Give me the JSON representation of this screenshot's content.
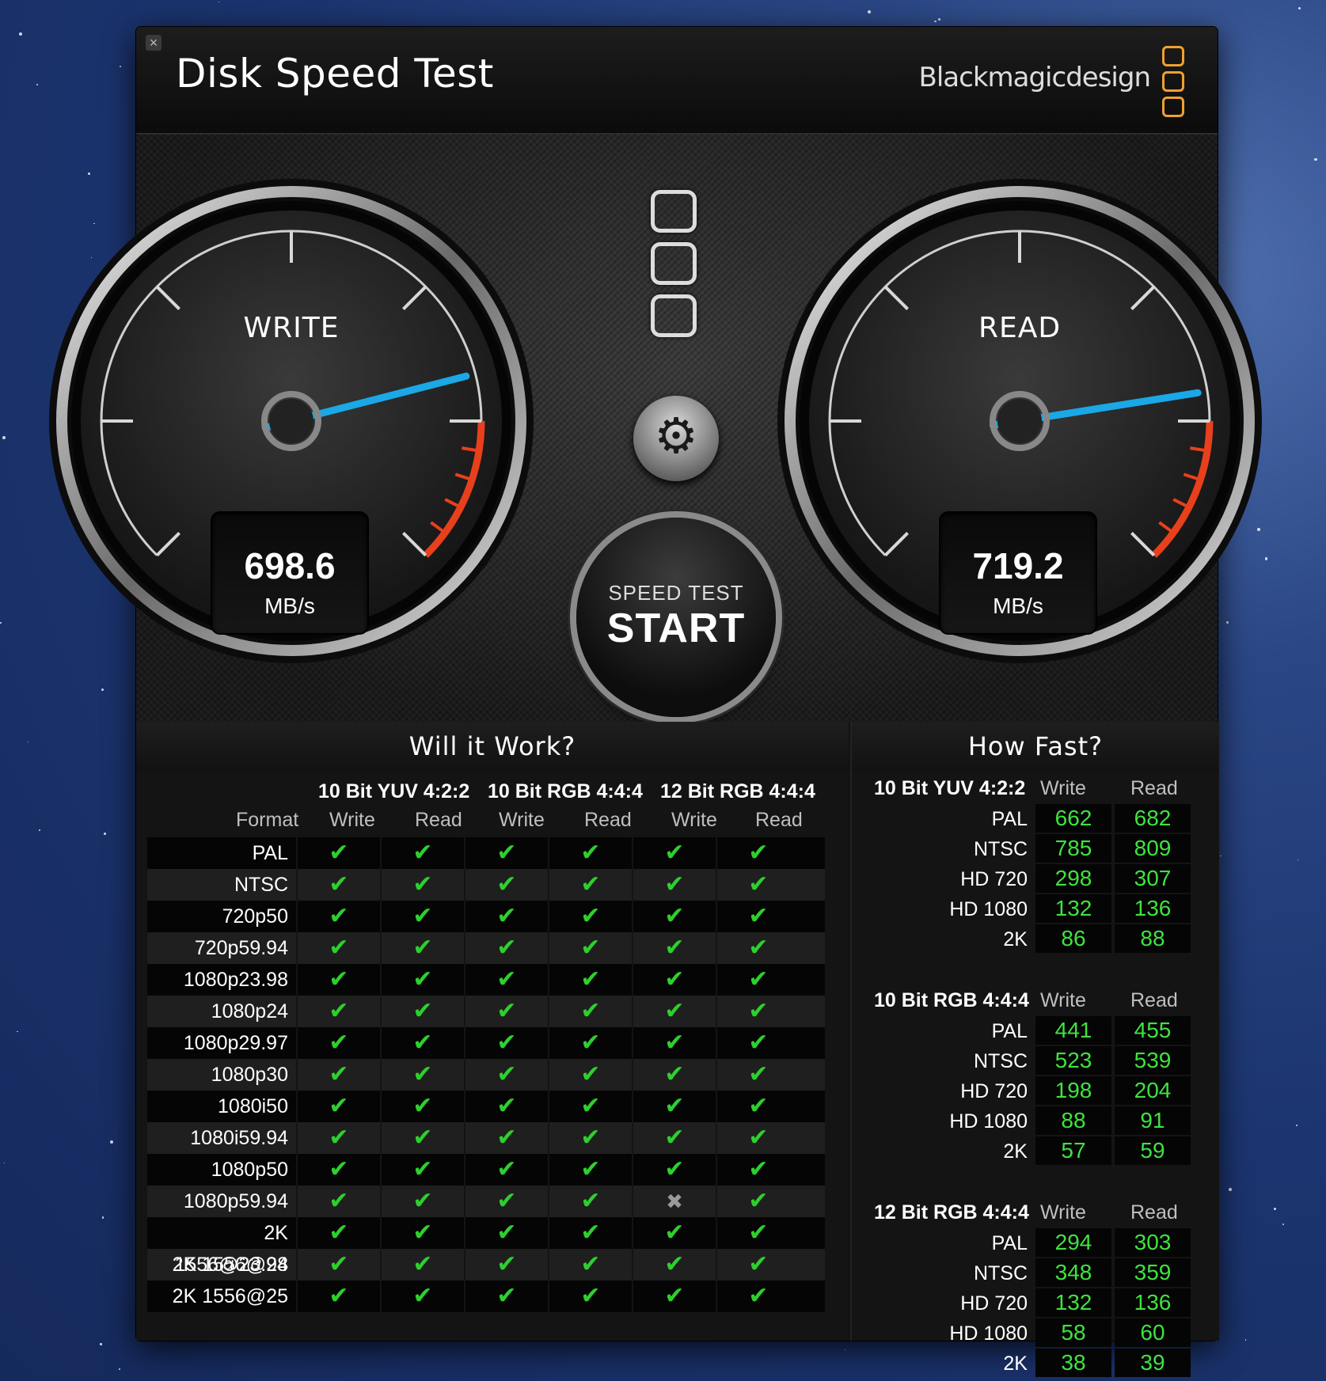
{
  "app": {
    "title": "Disk Speed Test",
    "brand": "Blackmagicdesign",
    "accent": "#f0a030"
  },
  "write_gauge": {
    "label": "WRITE",
    "value": "698.6",
    "unit": "MB/s",
    "needle_fraction": 0.78
  },
  "read_gauge": {
    "label": "READ",
    "value": "719.2",
    "unit": "MB/s",
    "needle_fraction": 0.8
  },
  "controls": {
    "settings_icon": "gear-icon",
    "start_sub": "SPEED TEST",
    "start_main": "START"
  },
  "will_it_work": {
    "title": "Will it Work?",
    "format_header": "Format",
    "groups": [
      "10 Bit YUV 4:2:2",
      "10 Bit RGB 4:4:4",
      "12 Bit RGB 4:4:4"
    ],
    "sub_headers": [
      "Write",
      "Read",
      "Write",
      "Read",
      "Write",
      "Read"
    ],
    "rows": [
      {
        "format": "PAL",
        "results": [
          true,
          true,
          true,
          true,
          true,
          true
        ]
      },
      {
        "format": "NTSC",
        "results": [
          true,
          true,
          true,
          true,
          true,
          true
        ]
      },
      {
        "format": "720p50",
        "results": [
          true,
          true,
          true,
          true,
          true,
          true
        ]
      },
      {
        "format": "720p59.94",
        "results": [
          true,
          true,
          true,
          true,
          true,
          true
        ]
      },
      {
        "format": "1080p23.98",
        "results": [
          true,
          true,
          true,
          true,
          true,
          true
        ]
      },
      {
        "format": "1080p24",
        "results": [
          true,
          true,
          true,
          true,
          true,
          true
        ]
      },
      {
        "format": "1080p29.97",
        "results": [
          true,
          true,
          true,
          true,
          true,
          true
        ]
      },
      {
        "format": "1080p30",
        "results": [
          true,
          true,
          true,
          true,
          true,
          true
        ]
      },
      {
        "format": "1080i50",
        "results": [
          true,
          true,
          true,
          true,
          true,
          true
        ]
      },
      {
        "format": "1080i59.94",
        "results": [
          true,
          true,
          true,
          true,
          true,
          true
        ]
      },
      {
        "format": "1080p50",
        "results": [
          true,
          true,
          true,
          true,
          true,
          true
        ]
      },
      {
        "format": "1080p59.94",
        "results": [
          true,
          true,
          true,
          true,
          false,
          true
        ]
      },
      {
        "format": "2K 1556@23.98",
        "results": [
          true,
          true,
          true,
          true,
          true,
          true
        ]
      },
      {
        "format": "2K 1556@24",
        "results": [
          true,
          true,
          true,
          true,
          true,
          true
        ]
      },
      {
        "format": "2K 1556@25",
        "results": [
          true,
          true,
          true,
          true,
          true,
          true
        ]
      }
    ]
  },
  "how_fast": {
    "title": "How Fast?",
    "write_header": "Write",
    "read_header": "Read",
    "sections": [
      {
        "name": "10 Bit YUV 4:2:2",
        "rows": [
          {
            "label": "PAL",
            "write": "662",
            "read": "682"
          },
          {
            "label": "NTSC",
            "write": "785",
            "read": "809"
          },
          {
            "label": "HD 720",
            "write": "298",
            "read": "307"
          },
          {
            "label": "HD 1080",
            "write": "132",
            "read": "136"
          },
          {
            "label": "2K",
            "write": "86",
            "read": "88"
          }
        ]
      },
      {
        "name": "10 Bit RGB 4:4:4",
        "rows": [
          {
            "label": "PAL",
            "write": "441",
            "read": "455"
          },
          {
            "label": "NTSC",
            "write": "523",
            "read": "539"
          },
          {
            "label": "HD 720",
            "write": "198",
            "read": "204"
          },
          {
            "label": "HD 1080",
            "write": "88",
            "read": "91"
          },
          {
            "label": "2K",
            "write": "57",
            "read": "59"
          }
        ]
      },
      {
        "name": "12 Bit RGB 4:4:4",
        "rows": [
          {
            "label": "PAL",
            "write": "294",
            "read": "303"
          },
          {
            "label": "NTSC",
            "write": "348",
            "read": "359"
          },
          {
            "label": "HD 720",
            "write": "132",
            "read": "136"
          },
          {
            "label": "HD 1080",
            "write": "58",
            "read": "60"
          },
          {
            "label": "2K",
            "write": "38",
            "read": "39"
          }
        ]
      }
    ]
  }
}
